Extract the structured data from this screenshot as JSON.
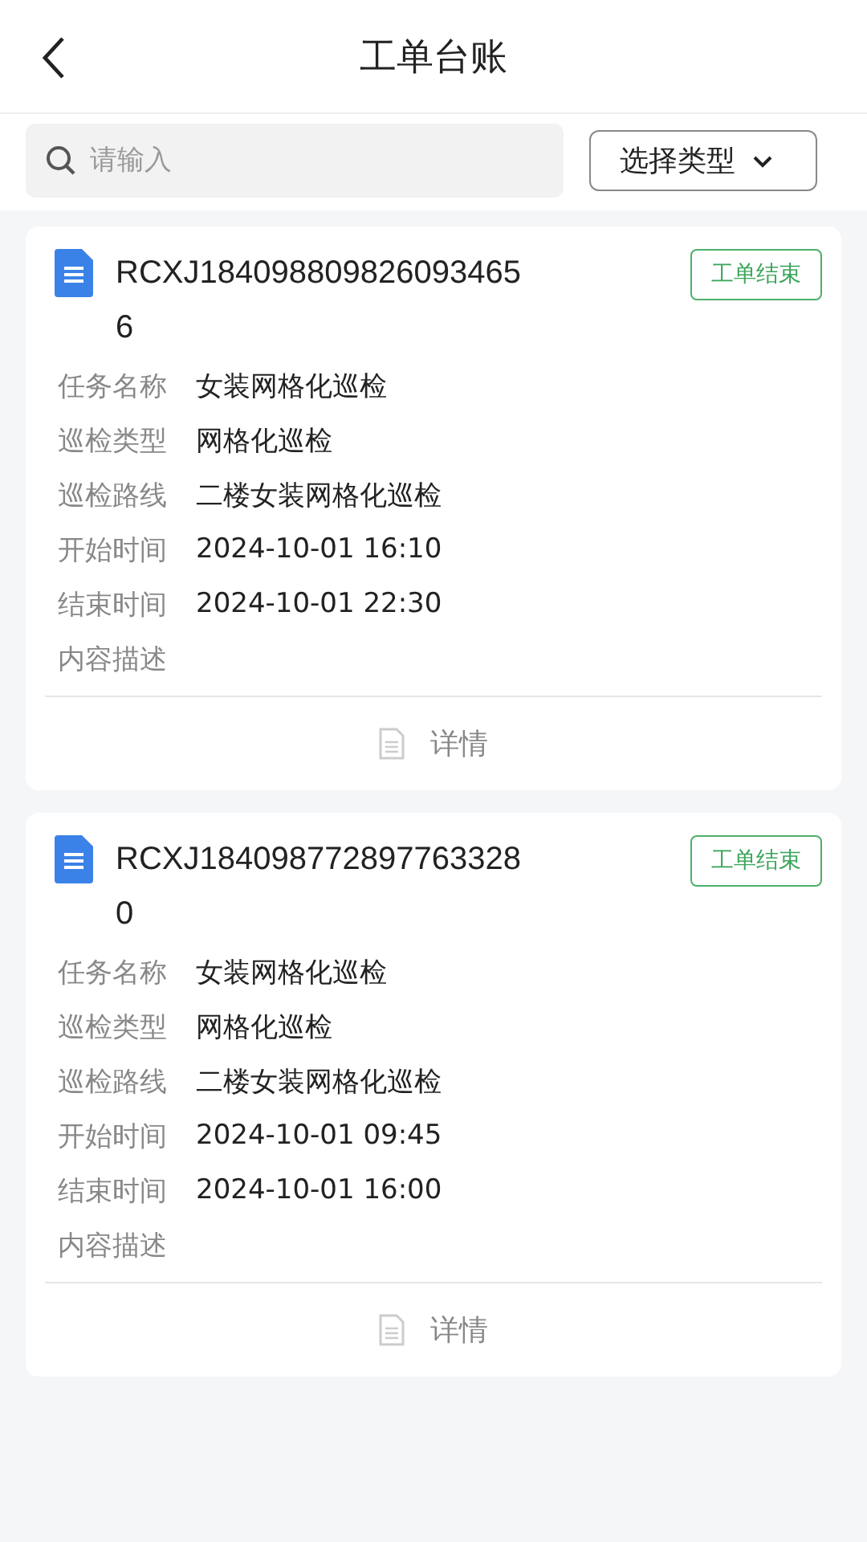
{
  "header": {
    "title": "工单台账"
  },
  "search": {
    "placeholder": "请输入"
  },
  "type_filter": {
    "label": "选择类型"
  },
  "orders": [
    {
      "number": "RCXJ1840988098260934656",
      "status": "工单结束",
      "fields": [
        {
          "label": "任务名称",
          "value": "女装网格化巡检"
        },
        {
          "label": "巡检类型",
          "value": "网格化巡检"
        },
        {
          "label": "巡检路线",
          "value": "二楼女装网格化巡检"
        },
        {
          "label": "开始时间",
          "value": "2024-10-01 16:10"
        },
        {
          "label": "结束时间",
          "value": "2024-10-01 22:30"
        },
        {
          "label": "内容描述"
        }
      ],
      "action": "详情"
    },
    {
      "number": "RCXJ1840987728977633280",
      "status": "工单结束",
      "fields": [
        {
          "label": "任务名称",
          "value": "女装网格化巡检"
        },
        {
          "label": "巡检类型",
          "value": "网格化巡检"
        },
        {
          "label": "巡检路线",
          "value": "二楼女装网格化巡检"
        },
        {
          "label": "开始时间",
          "value": "2024-10-01 09:45"
        },
        {
          "label": "结束时间",
          "value": "2024-10-01 16:00"
        },
        {
          "label": "内容描述"
        }
      ],
      "action": "详情"
    }
  ]
}
